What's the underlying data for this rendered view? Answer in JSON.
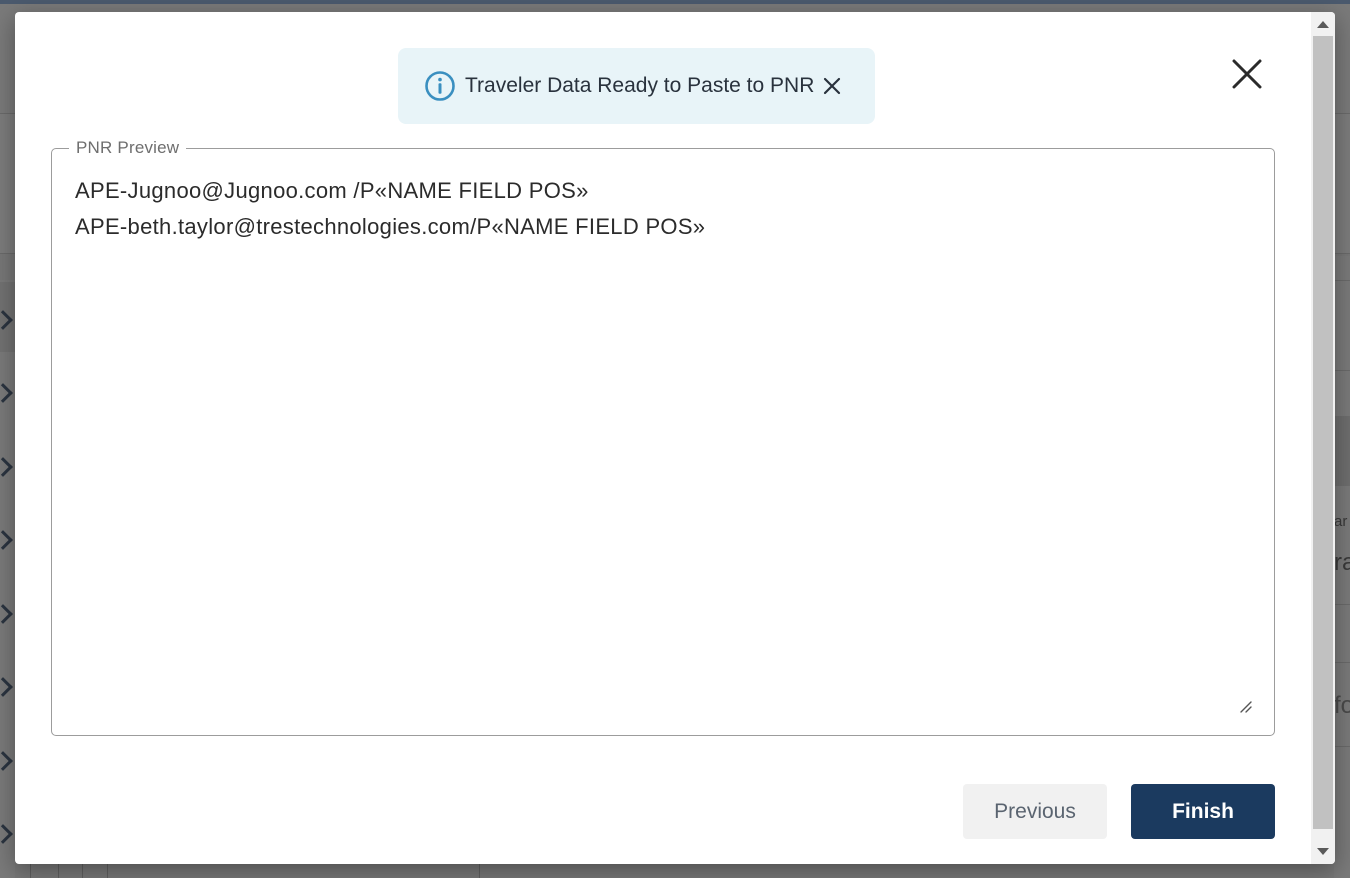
{
  "toast": {
    "message": "Traveler Data Ready to Paste to PNR",
    "info_icon": "info-circle-icon",
    "close_icon": "close-icon",
    "accent_color": "#3a8fc0",
    "background_color": "#e8f4f8"
  },
  "modal": {
    "close_icon": "close-icon"
  },
  "preview": {
    "legend": "PNR Preview",
    "lines": [
      "APE-Jugnoo@Jugnoo.com /P«NAME FIELD POS»",
      "APE-beth.taylor@trestechnologies.com/P«NAME FIELD POS»"
    ]
  },
  "buttons": {
    "previous": "Previous",
    "finish": "Finish",
    "primary_color": "#1b3a5f"
  },
  "background": {
    "fragments": [
      "ar",
      "ra",
      "fo"
    ]
  }
}
